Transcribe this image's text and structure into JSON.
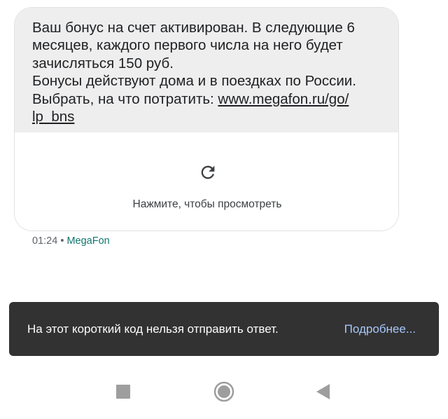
{
  "message": {
    "lines": [
      "Ваш бонус на счет активирован. В следующие 6",
      "месяцев, каждого первого числа на него будет",
      "зачисляться 150 руб.",
      "Бонусы действуют дома и в поездках по России.",
      "Выбрать, на что потратить: "
    ],
    "link_part1": "www.megafon.ru/go/",
    "link_part2": "lp_bns"
  },
  "preview": {
    "icon": "reload-icon",
    "label": "Нажмите, чтобы просмотреть"
  },
  "meta": {
    "time": "01:24",
    "separator": " • ",
    "sender": "MegaFon"
  },
  "snackbar": {
    "text": "На этот короткий код нельзя отправить ответ.",
    "action": "Подробнее..."
  },
  "navbar": {
    "icons": [
      "recents-square-icon",
      "home-circle-icon",
      "back-triangle-icon"
    ]
  },
  "colors": {
    "bubble_bg": "#eeeeee",
    "snackbar_bg": "#323232",
    "snackbar_action": "#a8c7fa",
    "sender": "#0f766e",
    "nav_icon": "#9e9e9e"
  }
}
